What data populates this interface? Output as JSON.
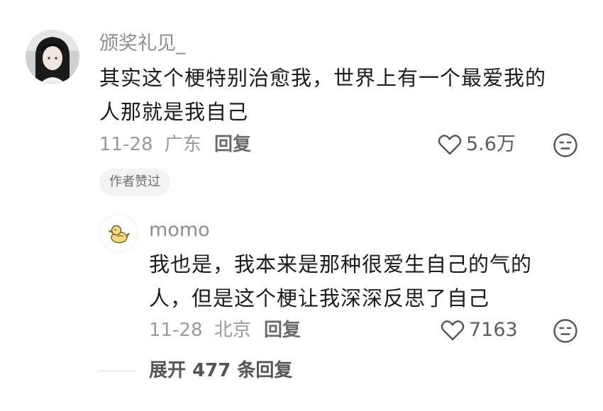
{
  "comment": {
    "username": "颁奖礼见_",
    "lines": [
      "其实这个梗特别治愈我，世界上有一个最爱我的",
      "人那就是我自己"
    ],
    "date": "11-28",
    "location": "广东",
    "reply_label": "回复",
    "like_count": "5.6万",
    "author_badge": "作者赞过"
  },
  "reply": {
    "username": "momo",
    "lines": [
      "我也是，我本来是那种很爱生自己的气的",
      "人，但是这个梗让我深深反思了自己"
    ],
    "date": "11-28",
    "location": "北京",
    "reply_label": "回复",
    "like_count": "7163"
  },
  "expand_replies_label": "展开 477 条回复",
  "icons": {
    "like": "heart-outline-icon",
    "dislike": "neutral-face-icon"
  },
  "colors": {
    "username": "#8e8e8e",
    "meta": "#9a9a9a",
    "badge_bg": "#f3f3f3"
  }
}
